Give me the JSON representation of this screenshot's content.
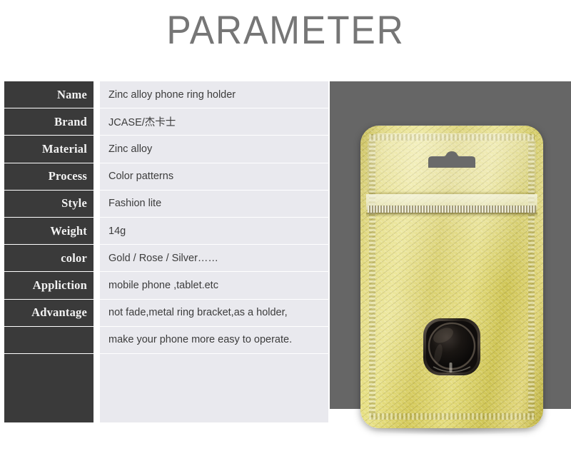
{
  "page": {
    "title": "PARAMETER",
    "title_color": "#767676",
    "background_color": "#ffffff"
  },
  "spec_table": {
    "label_bg_color": "#3a3a3a",
    "label_text_color": "#f2f2f2",
    "value_bg_color": "#e9e9ee",
    "value_text_color": "#3c3c3c",
    "rows": [
      {
        "label": "Name",
        "value": "Zinc alloy phone ring holder"
      },
      {
        "label": "Brand",
        "value": "JCASE/杰卡士"
      },
      {
        "label": "Material",
        "value": "Zinc alloy"
      },
      {
        "label": "Process",
        "value": "Color patterns"
      },
      {
        "label": "Style",
        "value": "Fashion lite"
      },
      {
        "label": "Weight",
        "value": "14g"
      },
      {
        "label": "color",
        "value": "Gold / Rose / Silver……"
      },
      {
        "label": "Appliction",
        "value": "mobile phone ,tablet.etc"
      },
      {
        "label": "Advantage",
        "value": "not fade,metal ring bracket,as a holder,"
      },
      {
        "label": "",
        "value": "make your phone more easy to operate."
      },
      {
        "label": "",
        "value": ""
      }
    ]
  },
  "product_panel": {
    "panel_bg_color": "#666666",
    "image_alt": "gold foil zip-lock pouch containing a black zinc alloy phone ring holder",
    "pouch": {
      "material_color": "#d8cf78",
      "hanger": "euro-slot-hole",
      "closure": "zip-lock strip"
    },
    "ring_holder": {
      "color": "#141414",
      "shape": "rounded-square base with circular ring and kickstand notch"
    }
  }
}
